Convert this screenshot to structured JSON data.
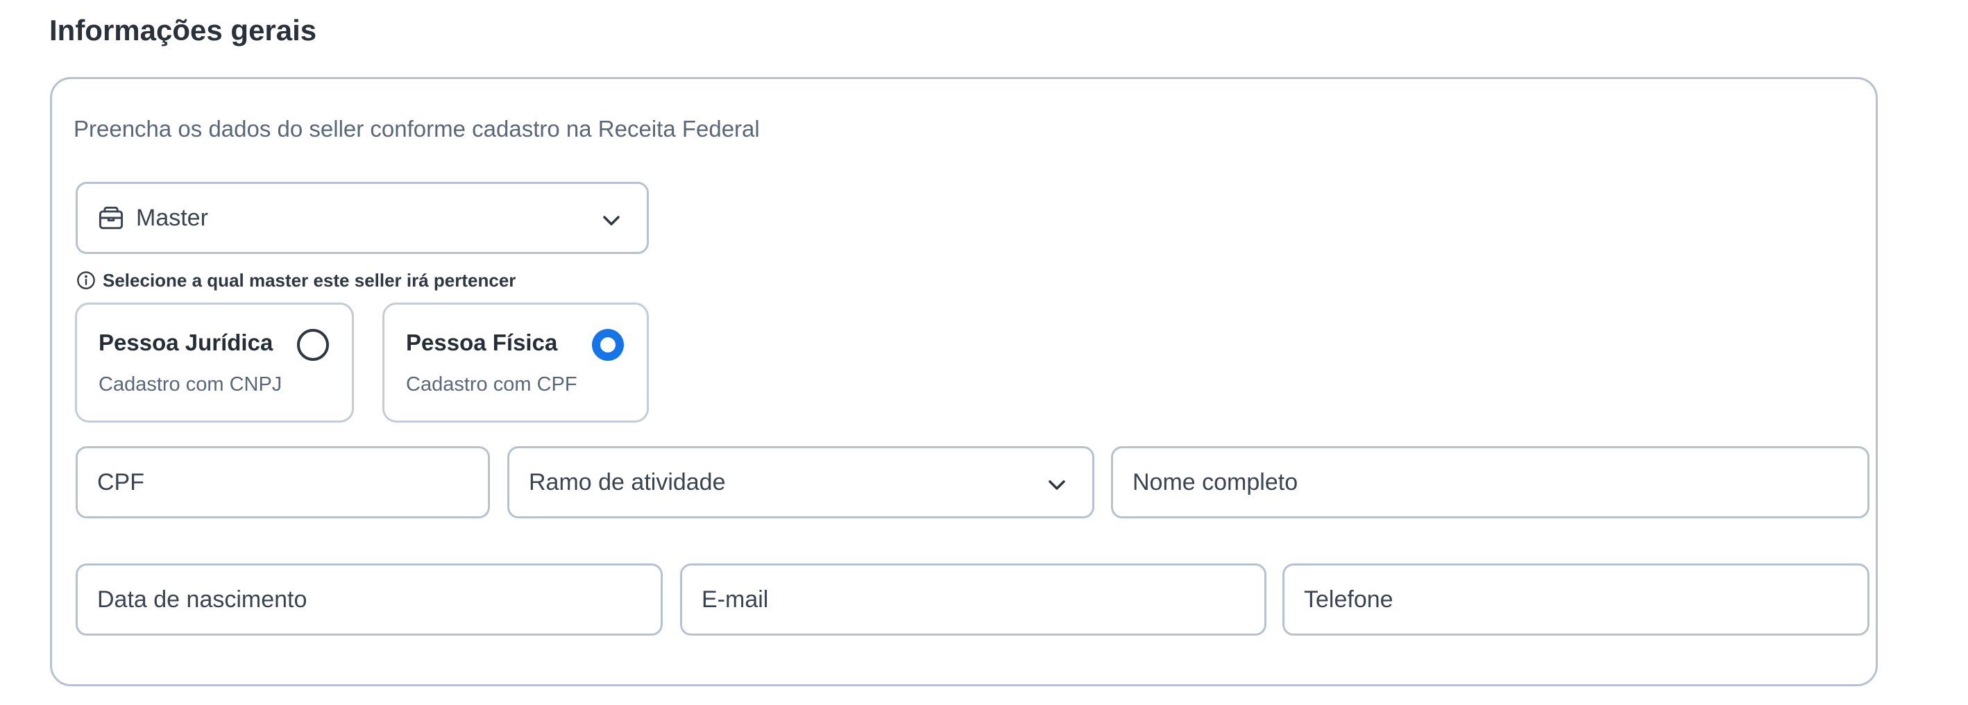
{
  "section": {
    "title": "Informações gerais"
  },
  "card": {
    "description": "Preencha os dados do seller conforme cadastro na Receita Federal"
  },
  "master": {
    "icon": "store-icon",
    "value": "Master",
    "hint_icon": "info-icon",
    "hint": "Selecione a qual master este seller irá pertencer"
  },
  "person_type": {
    "selected": "pessoa_fisica",
    "options": [
      {
        "id": "pessoa_juridica",
        "title": "Pessoa Jurídica",
        "subtitle": "Cadastro com CNPJ",
        "checked": false
      },
      {
        "id": "pessoa_fisica",
        "title": "Pessoa Física",
        "subtitle": "Cadastro com CPF",
        "checked": true
      }
    ]
  },
  "fields": {
    "cpf": {
      "placeholder": "CPF"
    },
    "ramo": {
      "placeholder": "Ramo de atividade"
    },
    "nome": {
      "placeholder": "Nome completo"
    },
    "nascimento": {
      "placeholder": "Data de nascimento"
    },
    "email": {
      "placeholder": "E-mail"
    },
    "telefone": {
      "placeholder": "Telefone"
    }
  },
  "colors": {
    "accent": "#1474e8",
    "border": "#b7c2cf",
    "text_primary": "#262d36",
    "text_secondary": "#5a6778"
  }
}
